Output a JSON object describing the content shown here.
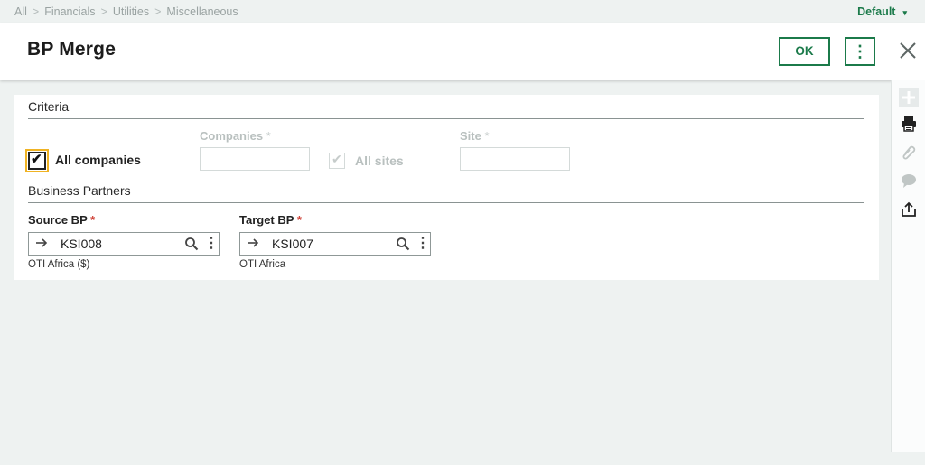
{
  "breadcrumb": {
    "items": [
      "All",
      "Financials",
      "Utilities",
      "Miscellaneous"
    ],
    "separator": ">"
  },
  "profile": {
    "label": "Default",
    "caret": "▾"
  },
  "header": {
    "title": "BP Merge",
    "ok_label": "OK",
    "more_glyph": "⋮",
    "close_glyph": "✕"
  },
  "criteria": {
    "section_title": "Criteria",
    "all_companies_label": "All companies",
    "all_companies_checked": true,
    "companies_label": "Companies",
    "companies_value": "",
    "all_sites_label": "All sites",
    "all_sites_checked": true,
    "site_label": "Site",
    "site_value": "",
    "required_star": "*"
  },
  "business_partners": {
    "section_title": "Business Partners",
    "source": {
      "label": "Source BP",
      "value": "KSI008",
      "description": "OTI Africa ($)"
    },
    "target": {
      "label": "Target BP",
      "value": "KSI007",
      "description": "OTI Africa"
    },
    "arrow_glyph": "➔",
    "required_star": "*"
  },
  "colors": {
    "accent_green": "#1b7a4a",
    "focus_yellow": "#f0b323",
    "required_red": "#d0453b",
    "page_bg": "#eef2f1"
  },
  "right_toolbar": {
    "icons": [
      "add-icon",
      "print-icon",
      "attachment-icon",
      "comment-icon",
      "export-icon"
    ]
  }
}
